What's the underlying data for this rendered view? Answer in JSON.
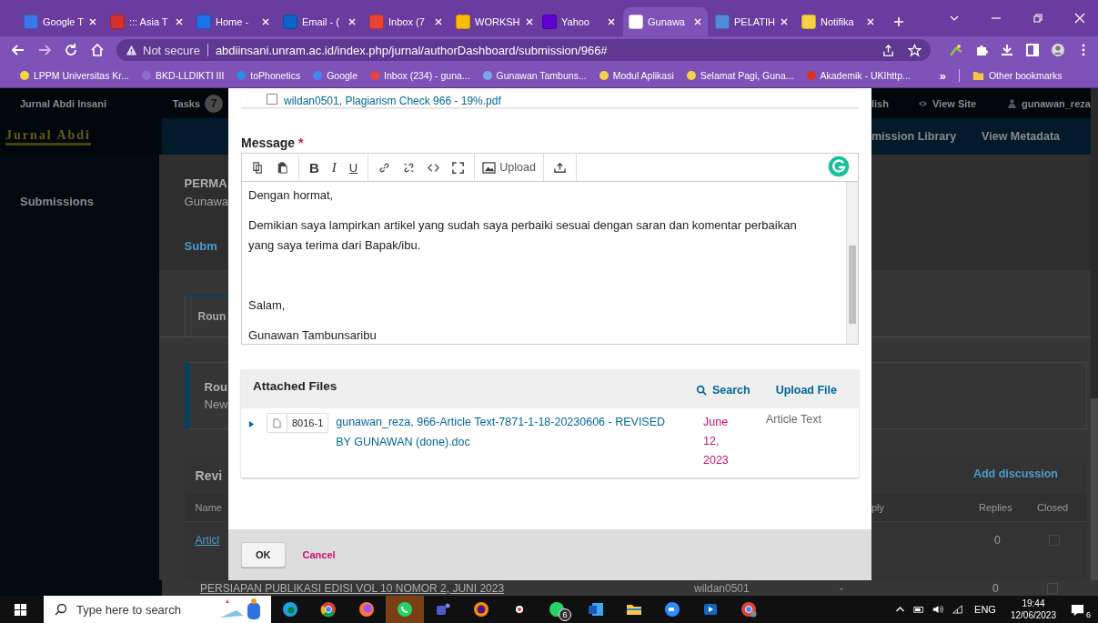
{
  "browser": {
    "tabs": [
      {
        "title": "Google T",
        "selected": false
      },
      {
        "title": "::: Asia T",
        "selected": false
      },
      {
        "title": "Home - ",
        "selected": false
      },
      {
        "title": "Email - (",
        "selected": false
      },
      {
        "title": "Inbox (7",
        "selected": false
      },
      {
        "title": "WORKSH",
        "selected": false
      },
      {
        "title": "Yahoo",
        "selected": false
      },
      {
        "title": "Gunawa",
        "selected": true
      },
      {
        "title": "PELATIH",
        "selected": false
      },
      {
        "title": "Notifika",
        "selected": false
      }
    ],
    "security": "Not secure",
    "url": "abdiinsani.unram.ac.id/index.php/jurnal/authorDashboard/submission/966#",
    "bookmarks": [
      "LPPM Universitas Kr...",
      "BKD-LLDIKTI III",
      "toPhonetics",
      "Google",
      "Inbox (234) - guna...",
      "Gunawan Tambuns...",
      "Modul Aplikasi",
      "Selamat Pagi, Guna...",
      "Akademik - UKIhttp..."
    ],
    "bookmarks_more": "»",
    "other_bookmarks": "Other bookmarks"
  },
  "site": {
    "name": "Jurnal Abdi Insani",
    "tasks_label": "Tasks",
    "tasks_count": "7",
    "language": "lish",
    "view_site": "View Site",
    "user": "gunawan_reza",
    "logo": "Jurnal Abdi",
    "nav": [
      "mission Library",
      "View Metadata"
    ],
    "sidebar": [
      "Submissions"
    ]
  },
  "submission": {
    "title": "PERMA",
    "author": "Gunawa",
    "tab": "Subm",
    "round_tab": "Roun",
    "notice_title": "Rou",
    "notice_text": "New"
  },
  "discussions": {
    "title": "Revi",
    "add": "Add discussion",
    "columns": [
      "Name",
      "ply",
      "Replies",
      "Closed"
    ],
    "rows": [
      {
        "name": "Articl",
        "replies": "0",
        "closed": false
      },
      {
        "name": "PERSIAPAN PUBLIKASI EDISI VOL 10 NOMOR 2, JUNI 2023",
        "from": "wildan0501",
        "last": "-",
        "replies": "0",
        "closed": false
      }
    ]
  },
  "dialog": {
    "previous_file": {
      "label": "wildan0501, Plagiarism Check 966 - 19%.pdf",
      "checked": false
    },
    "message_label": "Message",
    "required_mark": "*",
    "toolbar": [
      [
        {
          "kind": "copy"
        },
        {
          "kind": "paste"
        }
      ],
      [
        {
          "kind": "bold",
          "label": "B"
        },
        {
          "kind": "italic",
          "label": "I"
        },
        {
          "kind": "underline",
          "label": "U"
        }
      ],
      [
        {
          "kind": "link"
        },
        {
          "kind": "unlink"
        },
        {
          "kind": "code"
        },
        {
          "kind": "fullscreen"
        }
      ],
      [
        {
          "kind": "image",
          "label": "Upload"
        }
      ],
      [
        {
          "kind": "upload"
        }
      ]
    ],
    "body": [
      "Dengan hormat,",
      "Demikian saya lampirkan artikel yang sudah saya perbaiki sesuai dengan saran dan komentar perbaikan yang saya terima dari Bapak/ibu.",
      "Salam,",
      "Gunawan Tambunsaribu"
    ],
    "attached": {
      "title": "Attached Files",
      "search": "Search",
      "upload": "Upload File",
      "files": [
        {
          "id": "8016-1",
          "name": "gunawan_reza, 966-Article Text-7871-1-18-20230606 - REVISED BY GUNAWAN (done).doc",
          "date": "June 12, 2023",
          "type": "Article Text",
          "expanded": false
        }
      ]
    },
    "ok": "OK",
    "cancel": "Cancel"
  },
  "taskbar": {
    "search_placeholder": "Type here to search",
    "whatsapp_badge": "6",
    "language": "ENG",
    "time": "19:44",
    "date": "12/06/2023",
    "notifications": "6"
  }
}
